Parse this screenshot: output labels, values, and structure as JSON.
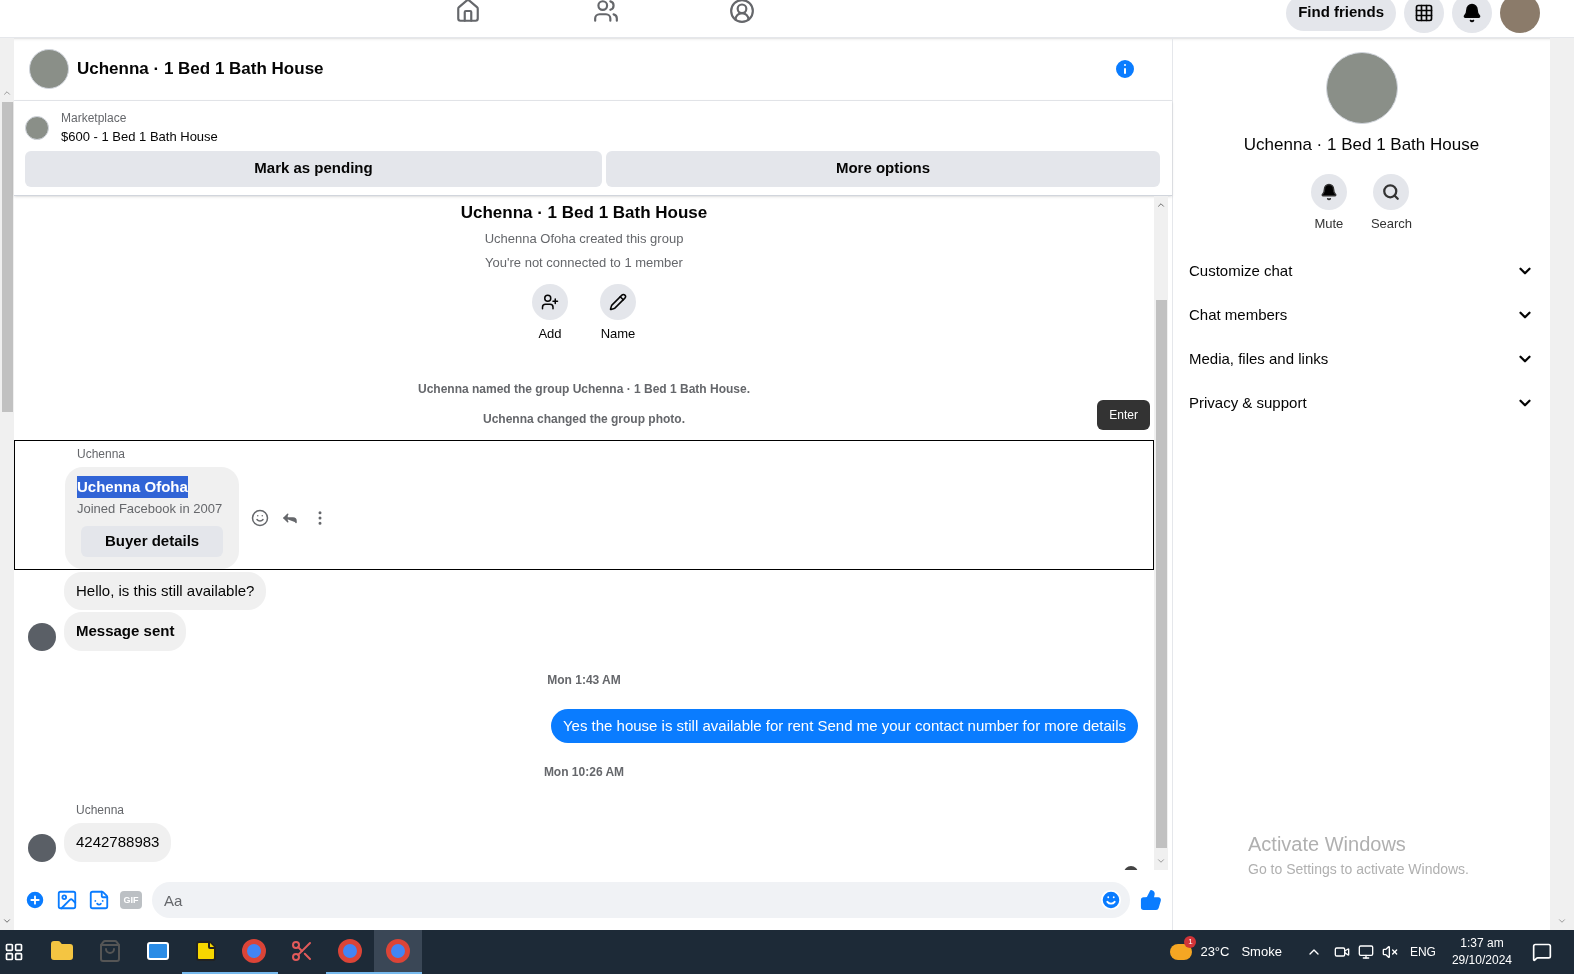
{
  "top_nav": {
    "find_friends": "Find friends"
  },
  "chat_header": {
    "title": "Uchenna · 1 Bed 1 Bath House"
  },
  "listing": {
    "source": "Marketplace",
    "title": "$600 - 1 Bed 1 Bath House",
    "buttons": [
      "Mark as pending",
      "More options"
    ]
  },
  "group_intro": {
    "title": "Uchenna · 1 Bed 1 Bath House",
    "lines": [
      "Uchenna Ofoha created this group",
      "You're not connected to 1 member"
    ],
    "actions": [
      {
        "kind": "add",
        "label": "Add"
      },
      {
        "kind": "name",
        "label": "Name"
      }
    ]
  },
  "events": [
    "Uchenna named the group Uchenna · 1 Bed 1 Bath House.",
    "Uchenna changed the group photo."
  ],
  "tooltip": "Enter",
  "messages": [
    {
      "kind": "card",
      "sender": "Uchenna",
      "name": "Uchenna Ofoha",
      "name_highlighted": true,
      "subtitle": "Joined Facebook in 2007",
      "button": "Buyer details",
      "focused": true
    },
    {
      "kind": "text",
      "text": "Hello, is this still available?",
      "avatar": false,
      "bold": false
    },
    {
      "kind": "text",
      "text": "Message sent",
      "avatar": true,
      "bold": true
    },
    {
      "kind": "time",
      "text": "Mon 1:43 AM"
    },
    {
      "kind": "outgoing",
      "text": "Yes the house is still available for rent Send me your contact number for more details"
    },
    {
      "kind": "time",
      "text": "Mon 10:26 AM"
    },
    {
      "kind": "sender",
      "text": "Uchenna"
    },
    {
      "kind": "text",
      "text": "4242788983",
      "avatar": true,
      "bold": false
    }
  ],
  "composer": {
    "placeholder": "Aa",
    "gif_label": "GIF"
  },
  "details_panel": {
    "title": "Uchenna · 1 Bed 1 Bath House",
    "actions": [
      {
        "kind": "mute",
        "label": "Mute"
      },
      {
        "kind": "search",
        "label": "Search"
      }
    ],
    "sections": [
      {
        "label": "Customize chat",
        "expanded": false
      },
      {
        "label": "Chat members",
        "expanded": false
      },
      {
        "label": "Media, files and links",
        "expanded": false
      },
      {
        "label": "Privacy & support",
        "expanded": false
      }
    ]
  },
  "activation_notice": {
    "title": "Activate Windows",
    "subtitle": "Go to Settings to activate Windows."
  },
  "taskbar": {
    "apps": [
      {
        "kind": "explorer",
        "running": false,
        "selected": false
      },
      {
        "kind": "store",
        "running": false,
        "selected": false
      },
      {
        "kind": "mail",
        "running": false,
        "selected": false
      },
      {
        "kind": "notes",
        "running": true,
        "selected": false
      },
      {
        "kind": "browser",
        "running": true,
        "selected": false
      },
      {
        "kind": "snip",
        "running": false,
        "selected": false
      },
      {
        "kind": "browser",
        "running": true,
        "selected": false
      },
      {
        "kind": "browser",
        "running": true,
        "selected": true
      }
    ],
    "weather": {
      "badge": "1",
      "temp": "23°C",
      "condition": "Smoke"
    },
    "language": "ENG",
    "time": "1:37 am",
    "date": "29/10/2024"
  }
}
